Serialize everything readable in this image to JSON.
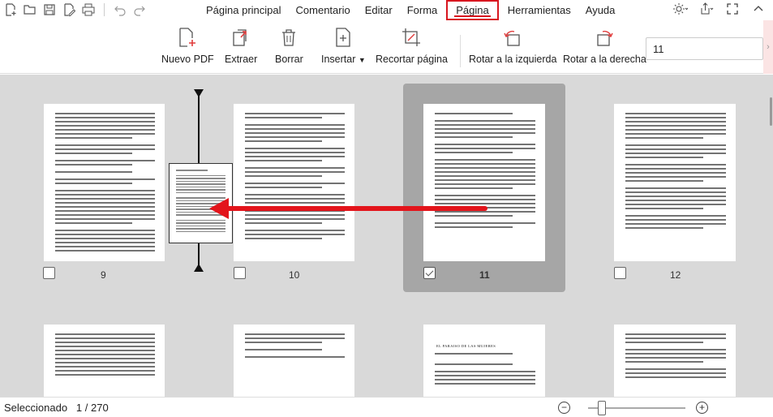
{
  "quick_icons": [
    "new-file-icon",
    "open-folder-icon",
    "save-icon",
    "edit-icon",
    "print-icon",
    "undo-icon",
    "redo-icon"
  ],
  "menus": [
    {
      "label": "Página principal",
      "active": false
    },
    {
      "label": "Comentario",
      "active": false
    },
    {
      "label": "Editar",
      "active": false
    },
    {
      "label": "Forma",
      "active": false
    },
    {
      "label": "Página",
      "active": true
    },
    {
      "label": "Herramientas",
      "active": false
    },
    {
      "label": "Ayuda",
      "active": false
    }
  ],
  "toolbar": {
    "new_pdf": "Nuevo PDF",
    "extract": "Extraer",
    "delete": "Borrar",
    "insert": "Insertar",
    "crop": "Recortar página",
    "rotate_left": "Rotar a la izquierda",
    "rotate_right": "Rotar a la derecha",
    "page_value": "11"
  },
  "pages": [
    {
      "number": "9",
      "checked": false,
      "selected": false
    },
    {
      "number": "10",
      "checked": false,
      "selected": false
    },
    {
      "number": "11",
      "checked": true,
      "selected": true
    },
    {
      "number": "12",
      "checked": false,
      "selected": false
    }
  ],
  "page_row2_title": "EL PARAISO DE LAS MUJERES",
  "status": {
    "selected_label": "Seleccionado",
    "current": "1",
    "separator": "/",
    "total": "270",
    "zoom_level": 0.1
  },
  "colors": {
    "accent": "#d8161f",
    "background": "#d9d9d9",
    "selected_bg": "#a6a6a6",
    "arrow": "#e3141b"
  }
}
